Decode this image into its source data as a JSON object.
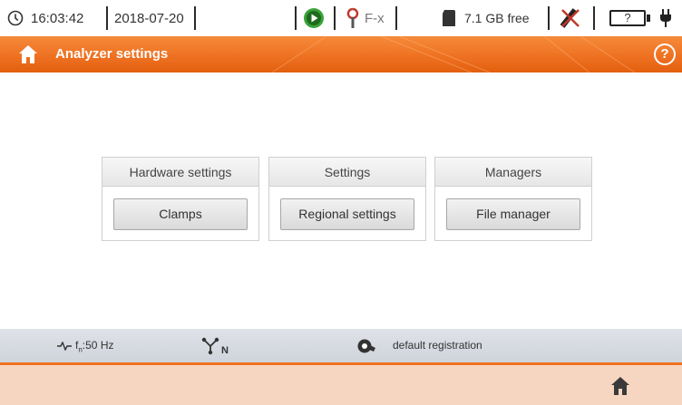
{
  "status": {
    "time": "16:03:42",
    "date": "2018-07-20",
    "clamp_label": "F-x",
    "storage": "7.1 GB free",
    "battery_level": "?"
  },
  "title": {
    "text": "Analyzer settings",
    "help": "?"
  },
  "groups": [
    {
      "header": "Hardware settings",
      "button": "Clamps"
    },
    {
      "header": "Settings",
      "button": "Regional settings"
    },
    {
      "header": "Managers",
      "button": "File manager"
    }
  ],
  "info": {
    "frequency": "fn:50 Hz",
    "frequency_main": "f",
    "frequency_sub": "n",
    "frequency_value": ":50 Hz",
    "network_sub": "N",
    "registration": "default registration"
  },
  "colors": {
    "accent": "#ee7222",
    "footer": "#f7d6c1"
  }
}
